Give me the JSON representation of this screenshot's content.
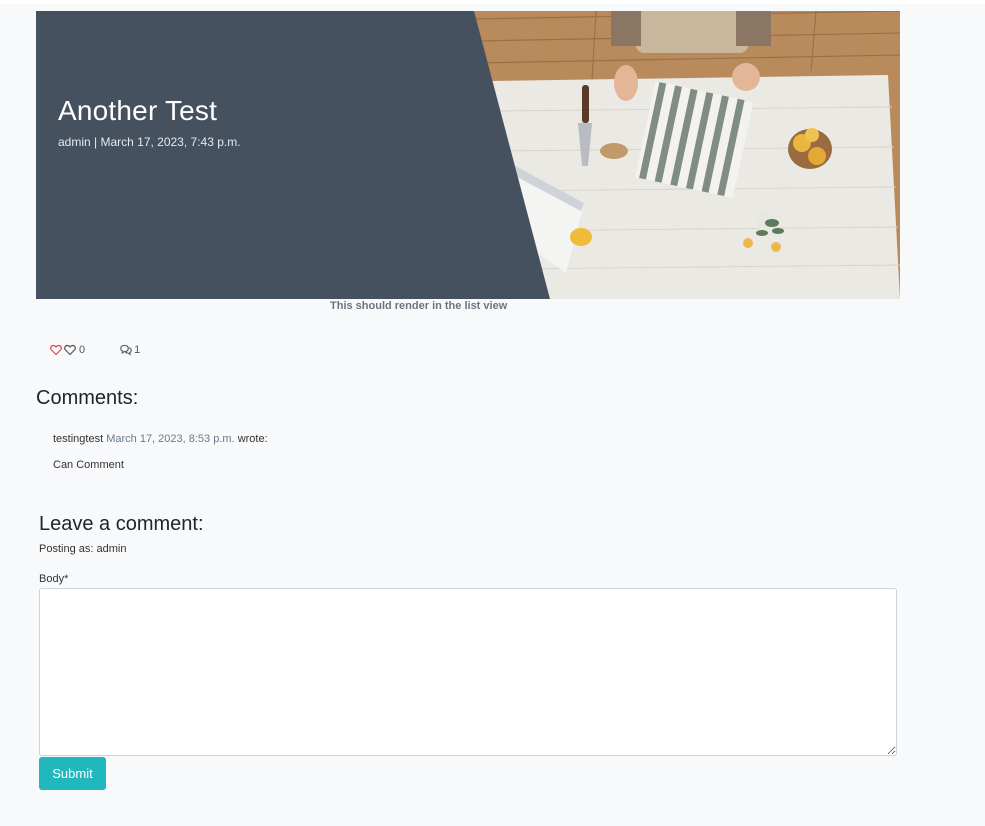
{
  "post": {
    "title": "Another Test",
    "meta": "admin | March 17, 2023, 7:43 p.m.",
    "excerpt": "This should render in the list view"
  },
  "stats": {
    "like_count": "0",
    "comment_count": "1"
  },
  "comments": {
    "heading": "Comments:",
    "items": [
      {
        "author": "testingtest",
        "date": "March 17, 2023, 8:53 p.m.",
        "verb": "wrote:",
        "body": "Can Comment"
      }
    ]
  },
  "form": {
    "heading": "Leave a comment:",
    "posting_as": "Posting as: admin",
    "body_label": "Body*",
    "body_value": "",
    "submit_label": "Submit"
  },
  "colors": {
    "panel": "#45515f",
    "accent": "#20b7bd",
    "heart": "#e0464f"
  }
}
